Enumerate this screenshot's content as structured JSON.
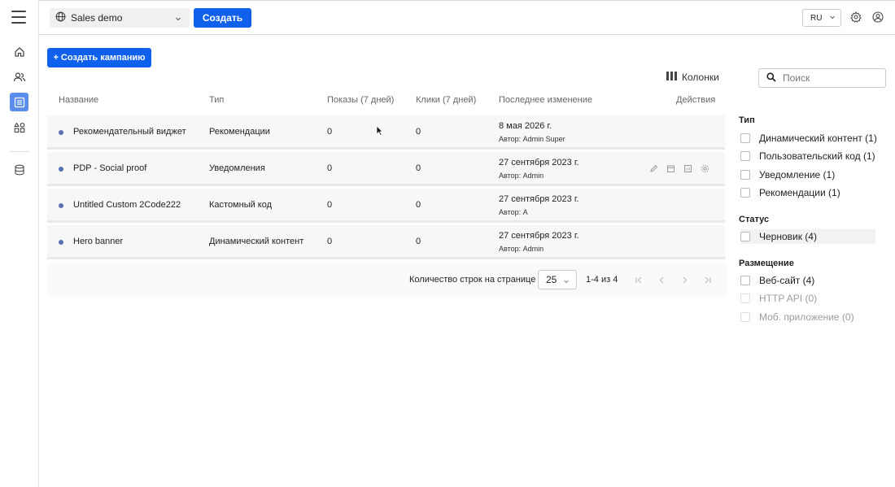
{
  "header": {
    "project": "Sales demo",
    "create_label": "Создать",
    "language": "RU"
  },
  "toolbar": {
    "create_campaign_label": "+ Создать кампанию",
    "columns_label": "Колонки",
    "search_placeholder": "Поиск"
  },
  "table": {
    "columns": [
      "Название",
      "Тип",
      "Показы (7 дней)",
      "Клики (7 дней)",
      "Последнее изменение",
      "Действия"
    ],
    "rows": [
      {
        "name": "Рекомендательный виджет",
        "type": "Рекомендации",
        "impressions": "0",
        "clicks": "0",
        "date": "8 мая 2026 г.",
        "author": "Автор: Admin Super"
      },
      {
        "name": "PDP - Social proof",
        "type": "Уведомления",
        "impressions": "0",
        "clicks": "0",
        "date": "27 сентября 2023 г.",
        "author": "Автор: Admin"
      },
      {
        "name": "Untitled Custom 2Code222",
        "type": "Кастомный код",
        "impressions": "0",
        "clicks": "0",
        "date": "27 сентября 2023 г.",
        "author": "Автор: A"
      },
      {
        "name": "Hero banner",
        "type": "Динамический контент",
        "impressions": "0",
        "clicks": "0",
        "date": "27 сентября 2023 г.",
        "author": "Автор: Admin"
      }
    ]
  },
  "pagination": {
    "rows_per_page_label": "Количество строк на странице",
    "rows_per_page": "25",
    "range": "1-4 из 4"
  },
  "filters": {
    "type_title": "Тип",
    "type_items": [
      "Динамический контент (1)",
      "Пользовательский код (1)",
      "Уведомление (1)",
      "Рекомендации (1)"
    ],
    "status_title": "Статус",
    "status_items": [
      "Черновик (4)"
    ],
    "placement_title": "Размещение",
    "placement_items": [
      "Веб-сайт (4)",
      "HTTP API (0)",
      "Моб. приложение (0)"
    ]
  },
  "colors": {
    "primary": "#1060ee",
    "active_nav": "#5b8def",
    "status_dot": "#5a70b0"
  }
}
